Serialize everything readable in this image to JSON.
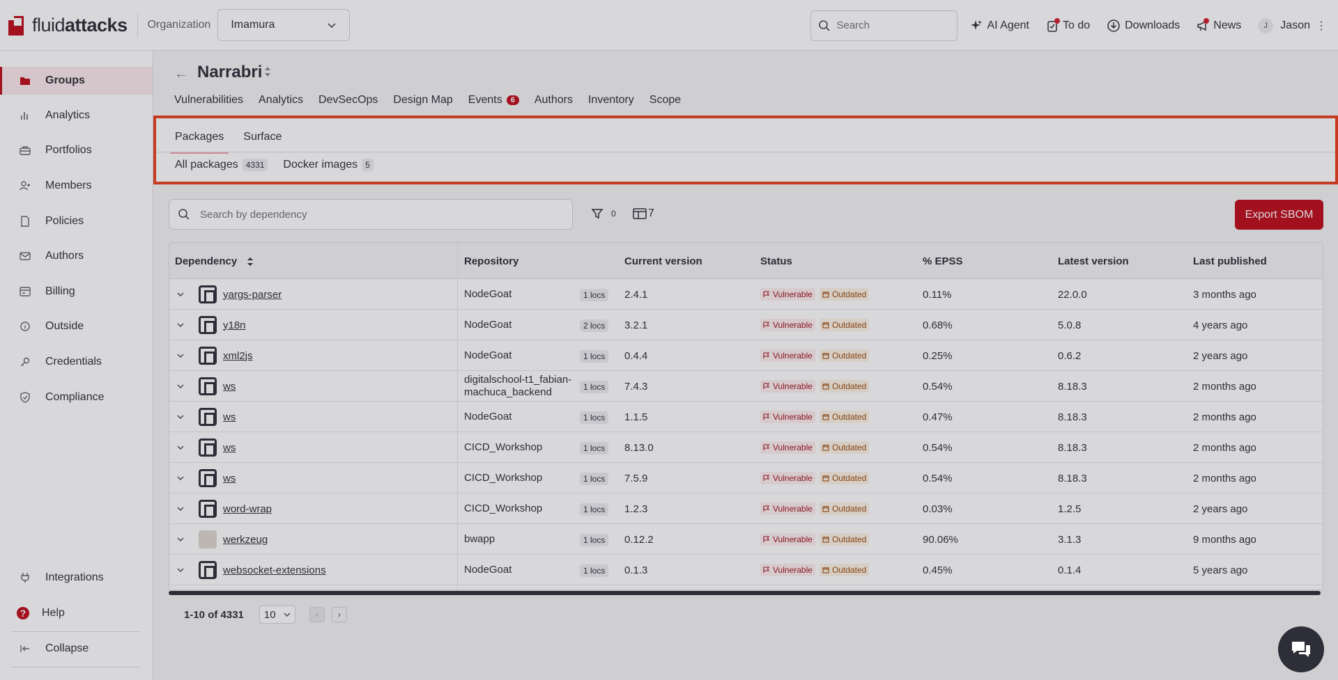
{
  "header": {
    "logo_text_light": "fluid",
    "logo_text_bold": "attacks",
    "org_label": "Organization",
    "org_value": "Imamura",
    "search_placeholder": "Search",
    "buttons": [
      "AI Agent",
      "To do",
      "Downloads",
      "News"
    ],
    "avatar_initial": "J",
    "user_name": "Jason"
  },
  "sidebar": {
    "items": [
      {
        "label": "Groups",
        "icon": "folder-icon",
        "active": true
      },
      {
        "label": "Analytics",
        "icon": "bar-chart-icon"
      },
      {
        "label": "Portfolios",
        "icon": "briefcase-icon"
      },
      {
        "label": "Members",
        "icon": "user-plus-icon"
      },
      {
        "label": "Policies",
        "icon": "document-icon"
      },
      {
        "label": "Authors",
        "icon": "mail-icon"
      },
      {
        "label": "Billing",
        "icon": "billing-icon"
      },
      {
        "label": "Outside",
        "icon": "info-circle-icon"
      },
      {
        "label": "Credentials",
        "icon": "key-icon"
      },
      {
        "label": "Compliance",
        "icon": "shield-check-icon"
      }
    ],
    "bottom": {
      "integrations": "Integrations",
      "help": "Help",
      "collapse": "Collapse"
    }
  },
  "group": {
    "title": "Narrabri",
    "tabs": [
      "Vulnerabilities",
      "Analytics",
      "DevSecOps",
      "Design Map",
      "Events",
      "Authors",
      "Inventory",
      "Scope"
    ],
    "events_count": "6"
  },
  "inventory": {
    "sub_tabs": [
      "Packages",
      "Surface"
    ],
    "package_tabs": [
      {
        "label": "All packages",
        "count": "4331"
      },
      {
        "label": "Docker images",
        "count": "5"
      }
    ],
    "search_placeholder": "Search by dependency",
    "filter_count": "0",
    "columns_count": "7",
    "export_label": "Export SBOM"
  },
  "table": {
    "headers": [
      "Dependency",
      "Repository",
      "Current version",
      "Status",
      "% EPSS",
      "Latest version",
      "Last published"
    ],
    "status_vulnerable": "Vulnerable",
    "status_outdated": "Outdated",
    "rows": [
      {
        "dep": "yargs-parser",
        "repo": "NodeGoat",
        "locs": "1 locs",
        "cur": "2.4.1",
        "epss": "0.11%",
        "latest": "22.0.0",
        "published": "3 months ago"
      },
      {
        "dep": "y18n",
        "repo": "NodeGoat",
        "locs": "2 locs",
        "cur": "3.2.1",
        "epss": "0.68%",
        "latest": "5.0.8",
        "published": "4 years ago"
      },
      {
        "dep": "xml2js",
        "repo": "NodeGoat",
        "locs": "1 locs",
        "cur": "0.4.4",
        "epss": "0.25%",
        "latest": "0.6.2",
        "published": "2 years ago"
      },
      {
        "dep": "ws",
        "repo": "digitalschool-t1_fabian-machuca_backend",
        "locs": "1 locs",
        "cur": "7.4.3",
        "epss": "0.54%",
        "latest": "8.18.3",
        "published": "2 months ago"
      },
      {
        "dep": "ws",
        "repo": "NodeGoat",
        "locs": "1 locs",
        "cur": "1.1.5",
        "epss": "0.47%",
        "latest": "8.18.3",
        "published": "2 months ago"
      },
      {
        "dep": "ws",
        "repo": "CICD_Workshop",
        "locs": "1 locs",
        "cur": "8.13.0",
        "epss": "0.54%",
        "latest": "8.18.3",
        "published": "2 months ago"
      },
      {
        "dep": "ws",
        "repo": "CICD_Workshop",
        "locs": "1 locs",
        "cur": "7.5.9",
        "epss": "0.54%",
        "latest": "8.18.3",
        "published": "2 months ago"
      },
      {
        "dep": "word-wrap",
        "repo": "CICD_Workshop",
        "locs": "1 locs",
        "cur": "1.2.3",
        "epss": "0.03%",
        "latest": "1.2.5",
        "published": "2 years ago"
      },
      {
        "dep": "werkzeug",
        "repo": "bwapp",
        "locs": "1 locs",
        "cur": "0.12.2",
        "epss": "90.06%",
        "latest": "3.1.3",
        "published": "9 months ago"
      },
      {
        "dep": "websocket-extensions",
        "repo": "NodeGoat",
        "locs": "1 locs",
        "cur": "0.1.3",
        "epss": "0.45%",
        "latest": "0.1.4",
        "published": "5 years ago"
      }
    ]
  },
  "pagination": {
    "range": "1-10 of 4331",
    "page_size": "10"
  }
}
